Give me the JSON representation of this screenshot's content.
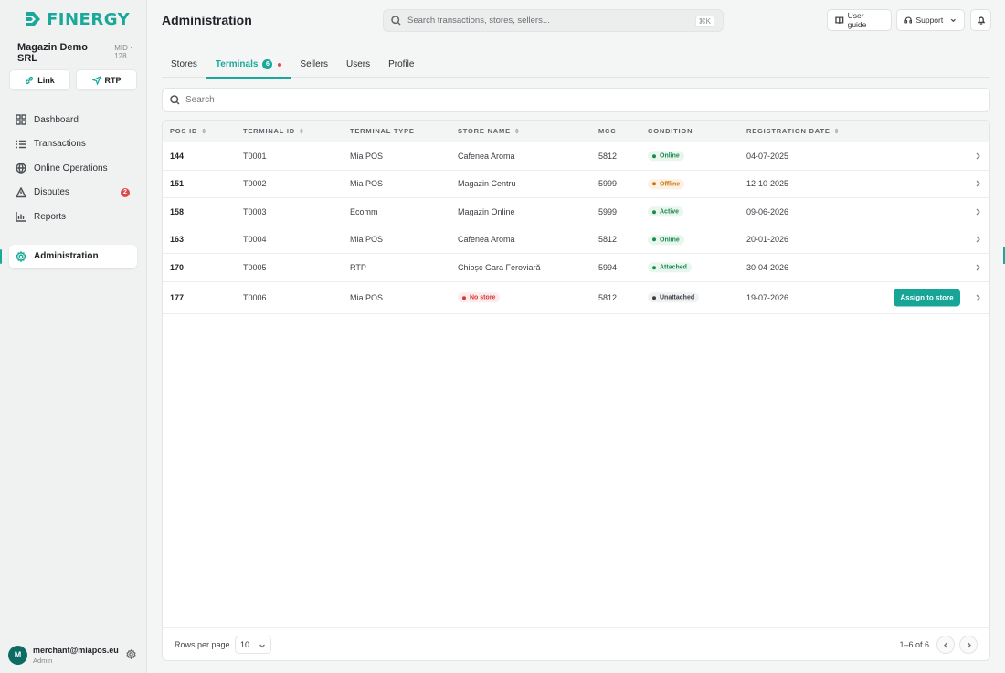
{
  "brand": {
    "name": "FINERGY",
    "color": "#1aa89a"
  },
  "merchant": {
    "name": "Magazin Demo SRL",
    "mid": "MID · 128"
  },
  "quick_actions": [
    {
      "label": "Link",
      "icon": "link-icon"
    },
    {
      "label": "RTP",
      "icon": "send-icon"
    }
  ],
  "nav": {
    "dashboard": "Dashboard",
    "transactions": "Transactions",
    "online_operations": "Online Operations",
    "disputes": "Disputes",
    "disputes_count": "2",
    "reports": "Reports",
    "administration": "Administration"
  },
  "user": {
    "initial": "M",
    "email": "merchant@miapos.eu",
    "role": "Admin"
  },
  "header": {
    "title": "Administration",
    "search_placeholder": "Search transactions, stores, sellers...",
    "shortcut": "⌘K",
    "user_guide": "User guide",
    "support": "Support"
  },
  "tabs": {
    "stores": "Stores",
    "terminals": "Terminals",
    "terminals_count": "6",
    "sellers": "Sellers",
    "users": "Users",
    "profile": "Profile"
  },
  "list_search_placeholder": "Search",
  "table": {
    "headers": {
      "pos_id": "POS ID",
      "terminal_id": "TERMINAL ID",
      "terminal_type": "TERMINAL TYPE",
      "store_name": "STORE NAME",
      "mcc": "MCC",
      "condition": "CONDITION",
      "registration_date": "REGISTRATION DATE"
    },
    "rows": [
      {
        "pos_id": "144",
        "terminal_id": "T0001",
        "type": "Mia POS",
        "store": "Cafenea Aroma",
        "mcc": "5812",
        "condition": "Online",
        "date": "04-07-2025"
      },
      {
        "pos_id": "151",
        "terminal_id": "T0002",
        "type": "Mia POS",
        "store": "Magazin Centru",
        "mcc": "5999",
        "condition": "Offline",
        "date": "12-10-2025"
      },
      {
        "pos_id": "158",
        "terminal_id": "T0003",
        "type": "Ecomm",
        "store": "Magazin Online",
        "mcc": "5999",
        "condition": "Active",
        "date": "09-06-2026"
      },
      {
        "pos_id": "163",
        "terminal_id": "T0004",
        "type": "Mia POS",
        "store": "Cafenea Aroma",
        "mcc": "5812",
        "condition": "Online",
        "date": "20-01-2026"
      },
      {
        "pos_id": "170",
        "terminal_id": "T0005",
        "type": "RTP",
        "store": "Chioșc Gara Feroviară",
        "mcc": "5994",
        "condition": "Attached",
        "date": "30-04-2026"
      },
      {
        "pos_id": "177",
        "terminal_id": "T0006",
        "type": "Mia POS",
        "store": "No store",
        "mcc": "5812",
        "condition": "Unattached",
        "date": "19-07-2026",
        "action": "Assign to store"
      }
    ]
  },
  "footer": {
    "rows_per_page_label": "Rows per page",
    "rows_per_page": "10",
    "range": "1–6 of 6"
  },
  "status_colors": {
    "online": "#e8f6ee",
    "offline": "#fdf1e3",
    "neutral": "#f0f1f2",
    "danger": "#fdecec"
  }
}
